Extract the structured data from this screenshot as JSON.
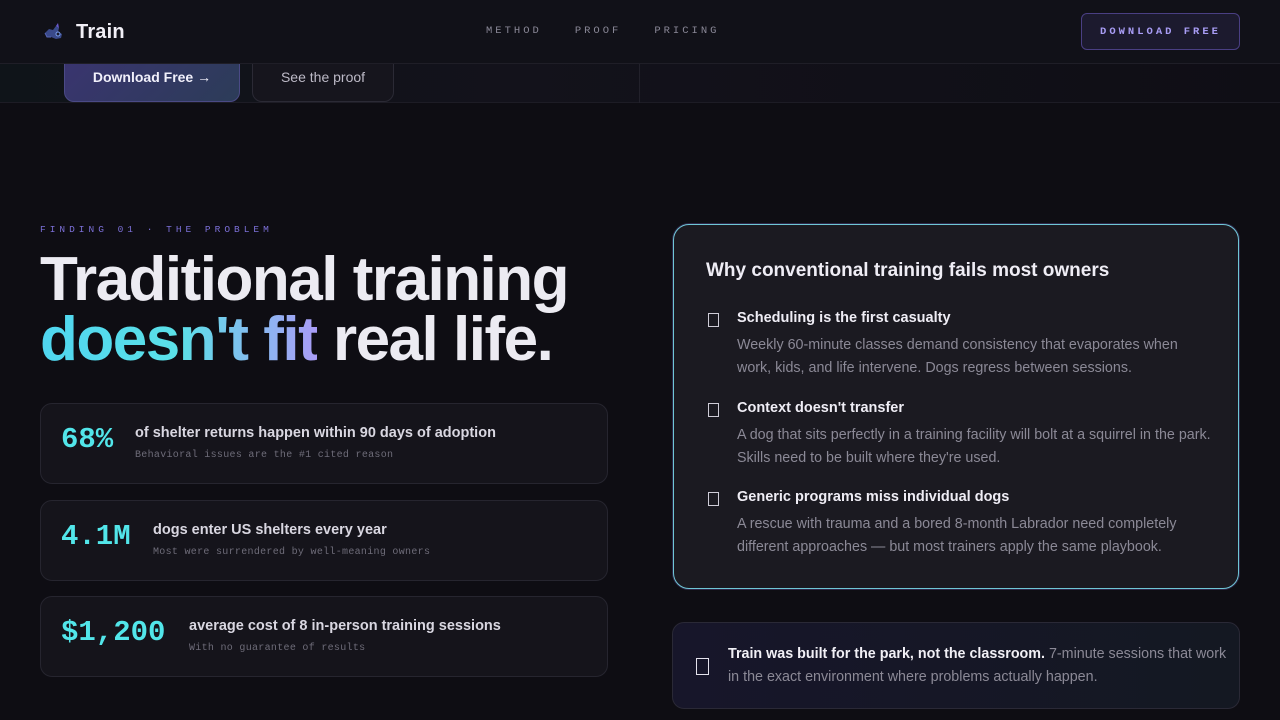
{
  "nav": {
    "brand": "Train",
    "links": [
      "METHOD",
      "PROOF",
      "PRICING"
    ],
    "cta": "DOWNLOAD FREE"
  },
  "hero_buttons": {
    "primary": "Download Free →",
    "secondary": "See the proof"
  },
  "problem": {
    "eyebrow": "FINDING 01 · THE PROBLEM",
    "headline_line1": "Traditional training",
    "headline_highlight": "doesn't fit",
    "headline_rest": " real life.",
    "stats": [
      {
        "value": "68%",
        "title": "of shelter returns happen within 90 days of adoption",
        "subtitle": "Behavioral issues are the #1 cited reason"
      },
      {
        "value": "4.1M",
        "title": "dogs enter US shelters every year",
        "subtitle": "Most were surrendered by well-meaning owners"
      },
      {
        "value": "$1,200",
        "title": "average cost of 8 in-person training sessions",
        "subtitle": "With no guarantee of results"
      }
    ]
  },
  "card": {
    "title": "Why conventional training fails most owners",
    "items": [
      {
        "title": "Scheduling is the first casualty",
        "text": "Weekly 60-minute classes demand consistency that evaporates when work, kids, and life intervene. Dogs regress between sessions."
      },
      {
        "title": "Context doesn't transfer",
        "text": "A dog that sits perfectly in a training facility will bolt at a squirrel in the park. Skills need to be built where they're used."
      },
      {
        "title": "Generic programs miss individual dogs",
        "text": "A rescue with trauma and a bored 8-month Labrador need completely different approaches — but most trainers apply the same playbook."
      }
    ]
  },
  "callout": {
    "strong": "Train was built for the park, not the classroom.",
    "text": " 7-minute sessions that work in the exact environment where problems actually happen."
  },
  "colors": {
    "accent_cyan": "#52e6ea",
    "accent_violet": "#a99df5",
    "background": "#0e0d13"
  }
}
